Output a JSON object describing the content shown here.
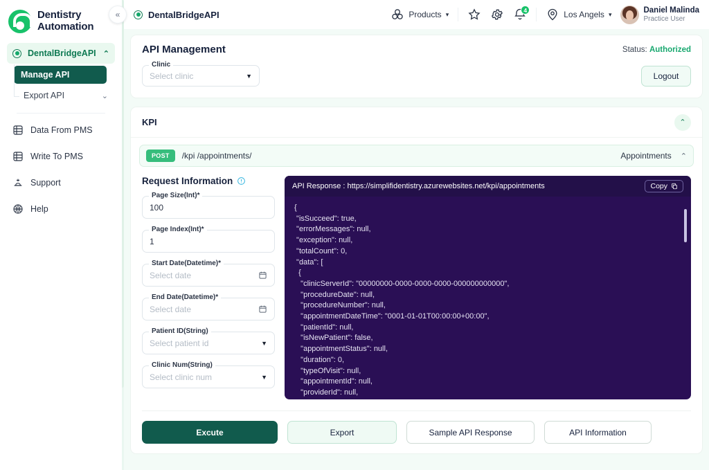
{
  "brand": {
    "line1": "Dentistry",
    "line2": "Automation",
    "accent": "#18c26a"
  },
  "sidebar": {
    "collapse_icon": "chevron-double-left-icon",
    "top_item": {
      "label": "DentalBridgeAPI",
      "chevron": "⌃"
    },
    "sub_items": [
      {
        "label": "Manage API",
        "active": true
      },
      {
        "label": "Export API",
        "active": false,
        "chevron": "⌄"
      }
    ],
    "items": [
      {
        "label": "Data From PMS",
        "icon": "database-in-icon"
      },
      {
        "label": "Write To PMS",
        "icon": "database-out-icon"
      },
      {
        "label": "Support",
        "icon": "support-icon"
      },
      {
        "label": "Help",
        "icon": "help-icon"
      }
    ]
  },
  "topbar": {
    "title": "DentalBridgeAPI",
    "products_label": "Products",
    "star_icon": "star-icon",
    "gear_icon": "gear-icon",
    "bell_icon": "bell-icon",
    "notification_count": "4",
    "location_label": "Los Angels",
    "user_name": "Daniel Malinda",
    "user_role": "Practice User"
  },
  "page": {
    "title": "API Management",
    "status_label": "Status:",
    "status_value": "Authorized",
    "clinic_label": "Clinic",
    "clinic_placeholder": "Select clinic",
    "logout_label": "Logout"
  },
  "kpi": {
    "title": "KPI",
    "collapse_chevron": "⌃",
    "endpoint": {
      "method": "POST",
      "path": "/kpi /appointments/",
      "tag": "Appointments",
      "chevron": "⌃"
    }
  },
  "request": {
    "heading": "Request Information",
    "info_icon": "info-icon",
    "fields": [
      {
        "label": "Page Size(Int)*",
        "value": "100",
        "placeholder": "",
        "control": "text"
      },
      {
        "label": "Page Index(Int)*",
        "value": "1",
        "placeholder": "",
        "control": "text"
      },
      {
        "label": "Start Date(Datetime)*",
        "value": "",
        "placeholder": "Select date",
        "control": "date"
      },
      {
        "label": "End Date(Datetime)*",
        "value": "",
        "placeholder": "Select date",
        "control": "date"
      },
      {
        "label": "Patient ID(String)",
        "value": "",
        "placeholder": "Select patient id",
        "control": "select"
      },
      {
        "label": "Clinic Num(String)",
        "value": "",
        "placeholder": "Select clinic num",
        "control": "select"
      }
    ]
  },
  "response": {
    "header": "API Response : https://simplifidentistry.azurewebsites.net/kpi/appointments",
    "copy_label": "Copy",
    "copy_icon": "copy-icon",
    "body": "{\n \"isSucceed\": true,\n \"errorMessages\": null,\n \"exception\": null,\n \"totalCount\": 0,\n \"data\": [\n  {\n   \"clinicServerId\": \"00000000-0000-0000-0000-000000000000\",\n   \"procedureDate\": null,\n   \"procedureNumber\": null,\n   \"appointmentDateTime\": \"0001-01-01T00:00:00+00:00\",\n   \"patientId\": null,\n   \"isNewPatient\": false,\n   \"appointmentStatus\": null,\n   \"duration\": 0,\n   \"typeOfVisit\": null,\n   \"appointmentId\": null,\n   \"providerId\": null,"
  },
  "actions": {
    "execute": "Excute",
    "export": "Export",
    "sample": "Sample API Response",
    "api_info": "API Information"
  }
}
